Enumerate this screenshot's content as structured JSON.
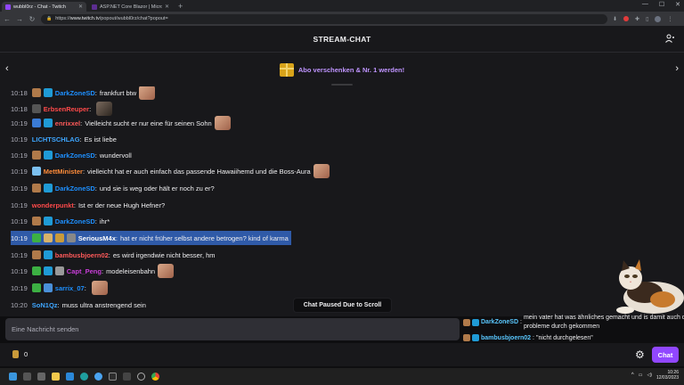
{
  "browser": {
    "tabs": [
      {
        "label": "wubbl0rz - Chat - Twitch",
        "active": true,
        "color": "#9147ff"
      },
      {
        "label": "ASP.NET Core Blazor | Microsoft",
        "active": false,
        "color": "#5c2d91"
      }
    ],
    "new_tab": "+",
    "url_scheme": "https://",
    "url_host": "www.twitch.tv",
    "url_path": "/popout/wubbl0rz/chat?popout="
  },
  "header": {
    "title": "STREAM-CHAT"
  },
  "promo": {
    "text": "Abo verschenken & Nr. 1 werden!"
  },
  "chat": {
    "messages": [
      {
        "time": "10:18",
        "user": "DarkZoneSD",
        "color": "#1e90ff",
        "text": "frankfurt btw",
        "emote": true
      },
      {
        "time": "10:18",
        "user": "ErbsenReuper",
        "color": "#ff4a4a",
        "text": "",
        "emote": true,
        "dark": true
      },
      {
        "time": "10:19",
        "user": "enrixxel",
        "color": "#ff5a5a",
        "text": "Vielleicht sucht er nur eine für seinen Sohn",
        "emote": true
      },
      {
        "time": "10:19",
        "user": "LICHTSCHLAG",
        "color": "#3ea6ff",
        "text": "Es ist liebe",
        "emote": false
      },
      {
        "time": "10:19",
        "user": "DarkZoneSD",
        "color": "#1e90ff",
        "text": "wundervoll",
        "emote": false
      },
      {
        "time": "10:19",
        "user": "MettMinister",
        "color": "#ff8c3a",
        "text": "vielleicht hat er auch einfach das passende Hawaiihemd und die Boss-Aura",
        "emote": true
      },
      {
        "time": "10:19",
        "user": "DarkZoneSD",
        "color": "#1e90ff",
        "text": "und sie is weg oder hält er noch zu er?",
        "emote": false
      },
      {
        "time": "10:19",
        "user": "wonderpunkt",
        "color": "#ff4a4a",
        "text": "Ist er der neue Hugh Hefner?",
        "emote": false
      },
      {
        "time": "10:19",
        "user": "DarkZoneSD",
        "color": "#1e90ff",
        "text": "ihr*",
        "emote": false
      },
      {
        "time": "10:19",
        "user": "SeriousM4x",
        "color": "#ffffff",
        "text": "hat er nicht früher selbst andere betrogen? kind of karma",
        "emote": false,
        "selected": true
      },
      {
        "time": "10:19",
        "user": "bambusbjoern02",
        "color": "#ff5a5a",
        "text": "es wird irgendwie nicht besser, hm",
        "emote": false
      },
      {
        "time": "10:19",
        "user": "Capt_Peng",
        "color": "#c83ed8",
        "text": "modeleisenbahn",
        "emote": true
      },
      {
        "time": "10:19",
        "user": "sarrix_07",
        "color": "#1e90ff",
        "text": "",
        "emote": true
      },
      {
        "time": "10:20",
        "user": "SoN1Qz",
        "color": "#3ea6ff",
        "text": "muss ultra anstrengend sein",
        "emote": false
      }
    ],
    "separator": ":",
    "paused_label": "Chat Paused Due to Scroll"
  },
  "overlay": {
    "messages": [
      {
        "user": "DarkZoneSD",
        "text": "mein vater hat was ähnliches gemacht und is damit auch ohne probleme durch gekommen"
      },
      {
        "user": "bambusbjoern02",
        "text": "\"nicht durchgelesen\""
      }
    ]
  },
  "input": {
    "placeholder": "Eine Nachricht senden"
  },
  "bottom": {
    "points": "0",
    "chat_button": "Chat"
  },
  "taskbar": {
    "time": "10:26",
    "date": "12/03/2023"
  }
}
